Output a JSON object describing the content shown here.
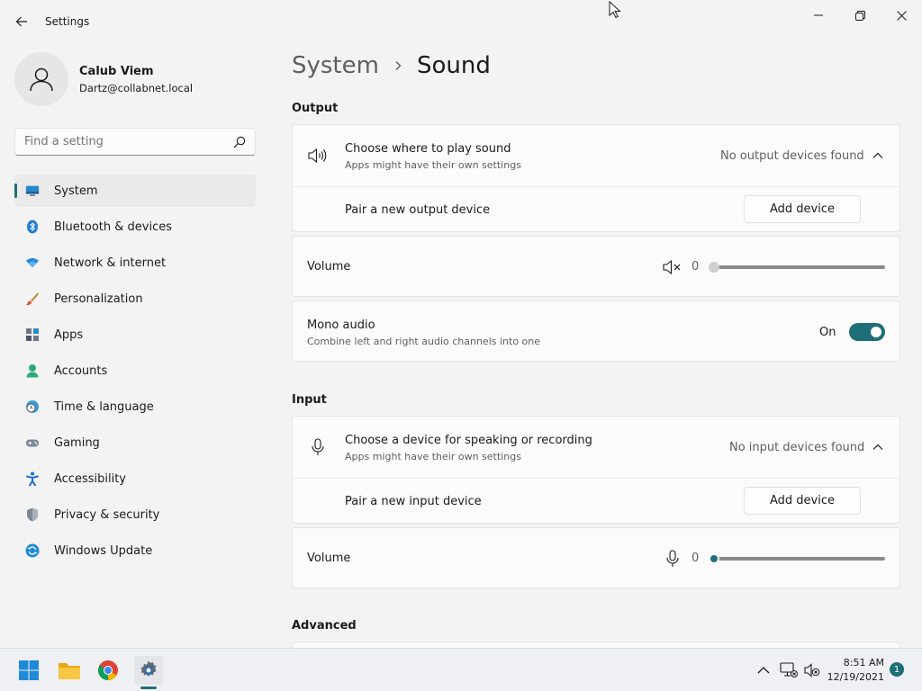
{
  "window": {
    "title": "Settings"
  },
  "profile": {
    "name": "Calub Viem",
    "email": "Dartz@collabnet.local"
  },
  "search": {
    "placeholder": "Find a setting"
  },
  "sidebar": {
    "items": [
      {
        "label": "System",
        "icon": "system-icon",
        "active": true
      },
      {
        "label": "Bluetooth & devices",
        "icon": "bluetooth-icon"
      },
      {
        "label": "Network & internet",
        "icon": "wifi-icon"
      },
      {
        "label": "Personalization",
        "icon": "brush-icon"
      },
      {
        "label": "Apps",
        "icon": "apps-icon"
      },
      {
        "label": "Accounts",
        "icon": "person-icon"
      },
      {
        "label": "Time & language",
        "icon": "clock-globe-icon"
      },
      {
        "label": "Gaming",
        "icon": "gamepad-icon"
      },
      {
        "label": "Accessibility",
        "icon": "accessibility-icon"
      },
      {
        "label": "Privacy & security",
        "icon": "shield-icon"
      },
      {
        "label": "Windows Update",
        "icon": "update-icon"
      }
    ]
  },
  "breadcrumb": {
    "parent": "System",
    "current": "Sound"
  },
  "output": {
    "heading": "Output",
    "choose_title": "Choose where to play sound",
    "choose_sub": "Apps might have their own settings",
    "status": "No output devices found",
    "pair_label": "Pair a new output device",
    "add_button": "Add device",
    "volume_label": "Volume",
    "volume_value": "0",
    "mono_title": "Mono audio",
    "mono_sub": "Combine left and right audio channels into one",
    "mono_state": "On"
  },
  "input": {
    "heading": "Input",
    "choose_title": "Choose a device for speaking or recording",
    "choose_sub": "Apps might have their own settings",
    "status": "No input devices found",
    "pair_label": "Pair a new input device",
    "add_button": "Add device",
    "volume_label": "Volume",
    "volume_value": "0"
  },
  "advanced": {
    "heading": "Advanced"
  },
  "taskbar": {
    "time": "8:51 AM",
    "date": "12/19/2021",
    "notifications": "1"
  },
  "colors": {
    "accent": "#1e6f76",
    "background": "#f3f3f3",
    "card": "#fbfbfb"
  }
}
